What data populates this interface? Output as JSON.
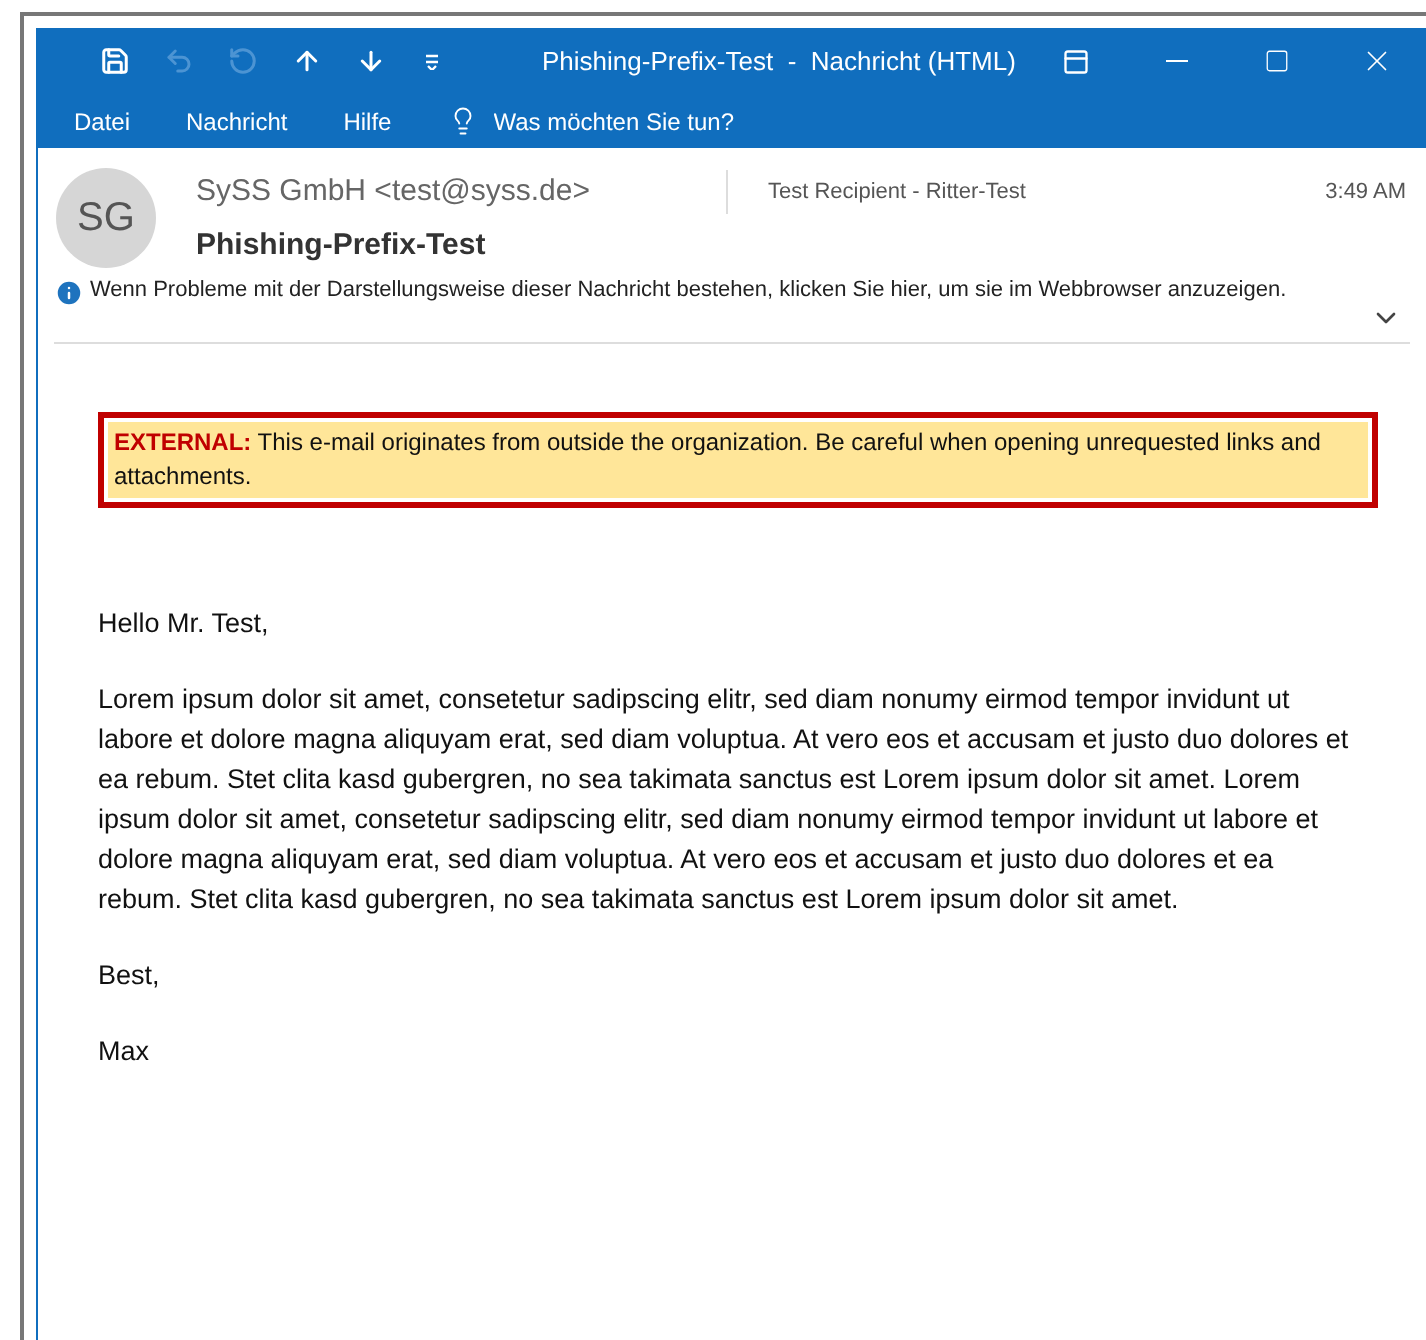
{
  "window": {
    "title": "Phishing-Prefix-Test  -  Nachricht (HTML)"
  },
  "quick_access": [
    {
      "kind": "save",
      "disabled": false
    },
    {
      "kind": "undo",
      "disabled": true
    },
    {
      "kind": "redo",
      "disabled": true
    },
    {
      "kind": "up",
      "disabled": false
    },
    {
      "kind": "down",
      "disabled": false
    },
    {
      "kind": "customize",
      "disabled": false
    }
  ],
  "menu": [
    "Datei",
    "Nachricht",
    "Hilfe"
  ],
  "tell_me": {
    "placeholder": "Was möchten Sie tun?"
  },
  "header": {
    "avatar": "SG",
    "sender": "SySS GmbH <test@syss.de>",
    "recipient": "Test Recipient - Ritter-Test",
    "time": "3:49 AM",
    "subject": "Phishing-Prefix-Test",
    "info": "Wenn Probleme mit der Darstellungsweise dieser Nachricht bestehen, klicken Sie hier, um sie im Webbrowser anzuzeigen."
  },
  "banner": "**EXTERNAL:** This e-mail originates from outside the organization. Be careful when opening unrequested links and attachments.",
  "body": [
    "Hello Mr. Test,",
    "Lorem ipsum dolor sit amet, consetetur sadipscing elitr, sed diam nonumy eirmod tempor invidunt ut labore et dolore magna aliquyam erat, sed diam voluptua. At vero eos et accusam et justo duo dolores et ea rebum. Stet clita kasd gubergren, no sea takimata sanctus est Lorem ipsum dolor sit amet. Lorem ipsum dolor sit amet, consetetur sadipscing elitr, sed diam nonumy eirmod tempor invidunt ut labore et dolore magna aliquyam erat, sed diam voluptua. At vero eos et accusam et justo duo dolores et ea rebum. Stet clita kasd gubergren, no sea takimata sanctus est Lorem ipsum dolor sit amet.",
    "Best,",
    "Max"
  ]
}
